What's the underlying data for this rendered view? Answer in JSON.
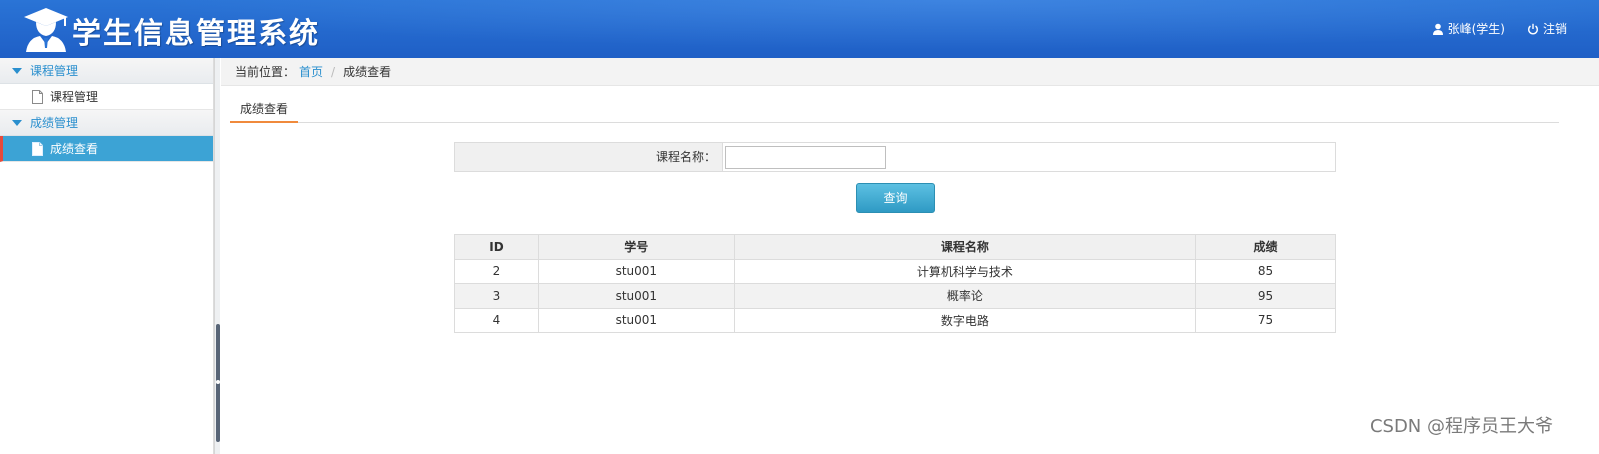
{
  "app": {
    "title": "学生信息管理系统"
  },
  "header": {
    "user_label": "张峰(学生)",
    "logout_label": "注销"
  },
  "sidebar": {
    "groups": [
      {
        "label": "课程管理",
        "items": [
          {
            "label": "课程管理"
          }
        ]
      },
      {
        "label": "成绩管理",
        "items": [
          {
            "label": "成绩查看"
          }
        ]
      }
    ]
  },
  "breadcrumb": {
    "prefix": "当前位置：",
    "home": "首页",
    "separator": "/",
    "current": "成绩查看"
  },
  "tab": {
    "label": "成绩查看"
  },
  "search": {
    "label": "课程名称：",
    "value": "",
    "placeholder": "",
    "button_label": "查询"
  },
  "table": {
    "headers": [
      "ID",
      "学号",
      "课程名称",
      "成绩"
    ],
    "rows": [
      [
        "2",
        "stu001",
        "计算机科学与技术",
        "85"
      ],
      [
        "3",
        "stu001",
        "概率论",
        "95"
      ],
      [
        "4",
        "stu001",
        "数字电路",
        "75"
      ]
    ]
  },
  "watermark": "CSDN @程序员王大爷",
  "colors": {
    "header": "#2a74d6",
    "accent": "#2a8fce",
    "active_item": "#3ca3d5",
    "active_marker": "#e64a3b",
    "tab_underline": "#f08a3c"
  }
}
